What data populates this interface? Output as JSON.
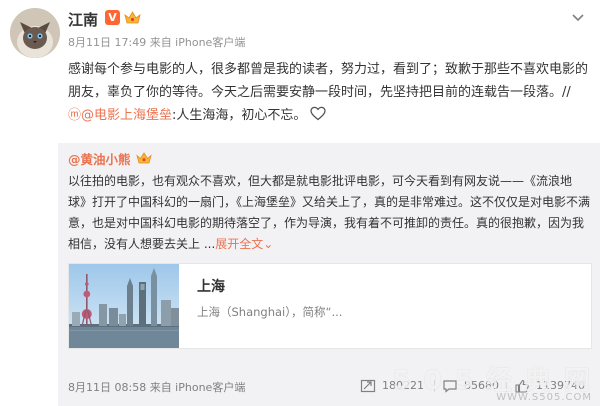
{
  "author": {
    "name": "江南",
    "vip_mark": "V",
    "meta": "8月11日 17:49 来自 iPhone客户端"
  },
  "post": {
    "text_before_link": "感谢每个参与电影的人，很多都曾是我的读者，努力过，看到了；致歉于那些不喜欢电影的朋友，辜负了你的等待。今天之后需要安静一段时间，先坚持把目前的连载告一段落。//",
    "link_icon": "ⓜ",
    "mention": "@电影上海堡垒",
    "text_after_link": ":人生海海，初心不忘。"
  },
  "repost": {
    "at": "@",
    "author": "黄油小熊",
    "text": "以往拍的电影，也有观众不喜欢，但大都是就电影批评电影，可今天看到有网友说——《流浪地球》打开了中国科幻的一扇门，《上海堡垒》又给关上了，真的是非常难过。这不仅仅是对电影不满意，也是对中国科幻电影的期待落空了，作为导演，我有着不可推卸的责任。真的很抱歉，因为我相信，没有人想要去关上 ...",
    "expand_label": "展开全文",
    "expand_arrow": "⌄",
    "card": {
      "title": "上海",
      "subtitle": "上海（Shanghai），简称“..."
    },
    "footer_meta": "8月11日 08:58 来自 iPhone客户端",
    "counts": {
      "repost": "180221",
      "comment": "85680",
      "like": "1139740"
    }
  },
  "watermark": {
    "main": "5 0 5 经 典 网",
    "sub": "WWW.S505.COM"
  },
  "colors": {
    "accent": "#eb7350",
    "meta": "#939393",
    "repost_bg": "#f2f2f5"
  }
}
